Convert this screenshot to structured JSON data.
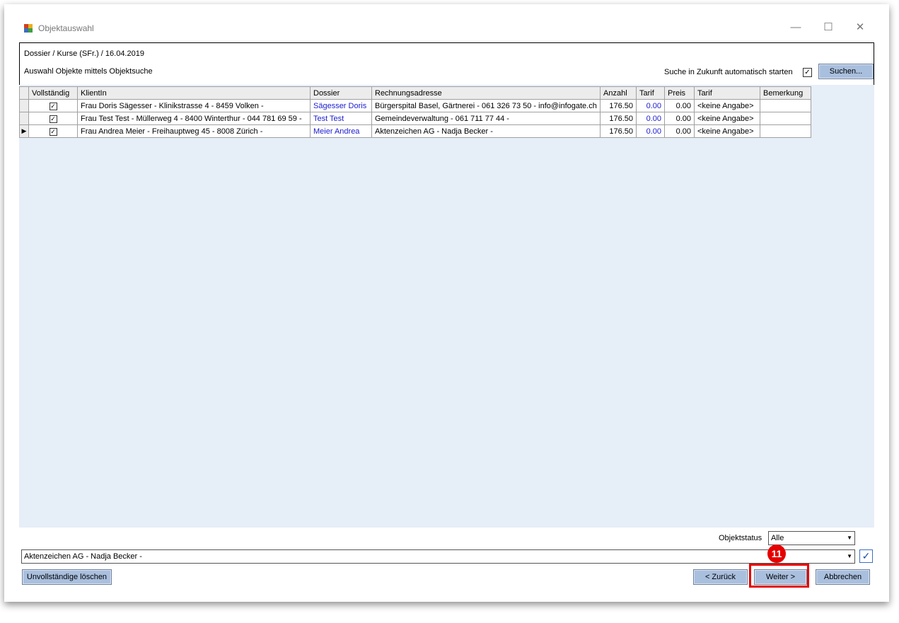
{
  "window": {
    "title": "Objektauswahl",
    "minimize": "—",
    "maximize": "☐",
    "close": "✕"
  },
  "header": {
    "context": "Dossier / Kurse (SFr.) / 16.04.2019",
    "subtitle": "Auswahl Objekte mittels Objektsuche",
    "auto_start_label": "Suche in Zukunft automatisch starten",
    "auto_start_checked": "✓",
    "search_button": "Suchen..."
  },
  "grid": {
    "columns": [
      "Vollständig",
      "KlientIn",
      "Dossier",
      "Rechnungsadresse",
      "Anzahl",
      "Tarif",
      "Preis",
      "Tarif",
      "Bemerkung"
    ],
    "rows": [
      {
        "indicator": "",
        "complete": "✓",
        "klient": "Frau Doris Sägesser -  Klinikstrasse 4 -  8459 Volken -",
        "dossier": "Sägesser Doris",
        "address": "Bürgerspital Basel, Gärtnerei -  061 326 73 50 -  info@infogate.ch",
        "anzahl": "176.50",
        "tarif": "0.00",
        "preis": "0.00",
        "tarif2": "<keine Angabe>",
        "bemerkung": ""
      },
      {
        "indicator": "",
        "complete": "✓",
        "klient": "Frau Test Test -  Müllerweg 4 -  8400 Winterthur -  044 781 69 59 -",
        "dossier": "Test Test",
        "address": "Gemeindeverwaltung -  061 711 77 44 -",
        "anzahl": "176.50",
        "tarif": "0.00",
        "preis": "0.00",
        "tarif2": "<keine Angabe>",
        "bemerkung": ""
      },
      {
        "indicator": "▶",
        "complete": "✓",
        "klient": "Frau Andrea Meier -  Freihauptweg 45 -  8008 Zürich -",
        "dossier": "Meier Andrea",
        "address": "Aktenzeichen AG -  Nadja Becker -",
        "anzahl": "176.50",
        "tarif": "0.00",
        "preis": "0.00",
        "tarif2": "<keine Angabe>",
        "bemerkung": ""
      }
    ]
  },
  "footer": {
    "status_label": "Objektstatus",
    "status_value": "Alle",
    "address_value": "Aktenzeichen AG -  Nadja Becker -",
    "confirm_icon": "✓",
    "delete_incomplete_button": "Unvollständige löschen",
    "back_button": "< Zurück",
    "next_button": "Weiter >",
    "cancel_button": "Abbrechen",
    "step_badge": "11"
  },
  "colors": {
    "grid_background": "#e6eef8",
    "button_fill": "#a9bfde",
    "highlight": "#e60000",
    "link_blue": "#1a1ad0"
  }
}
